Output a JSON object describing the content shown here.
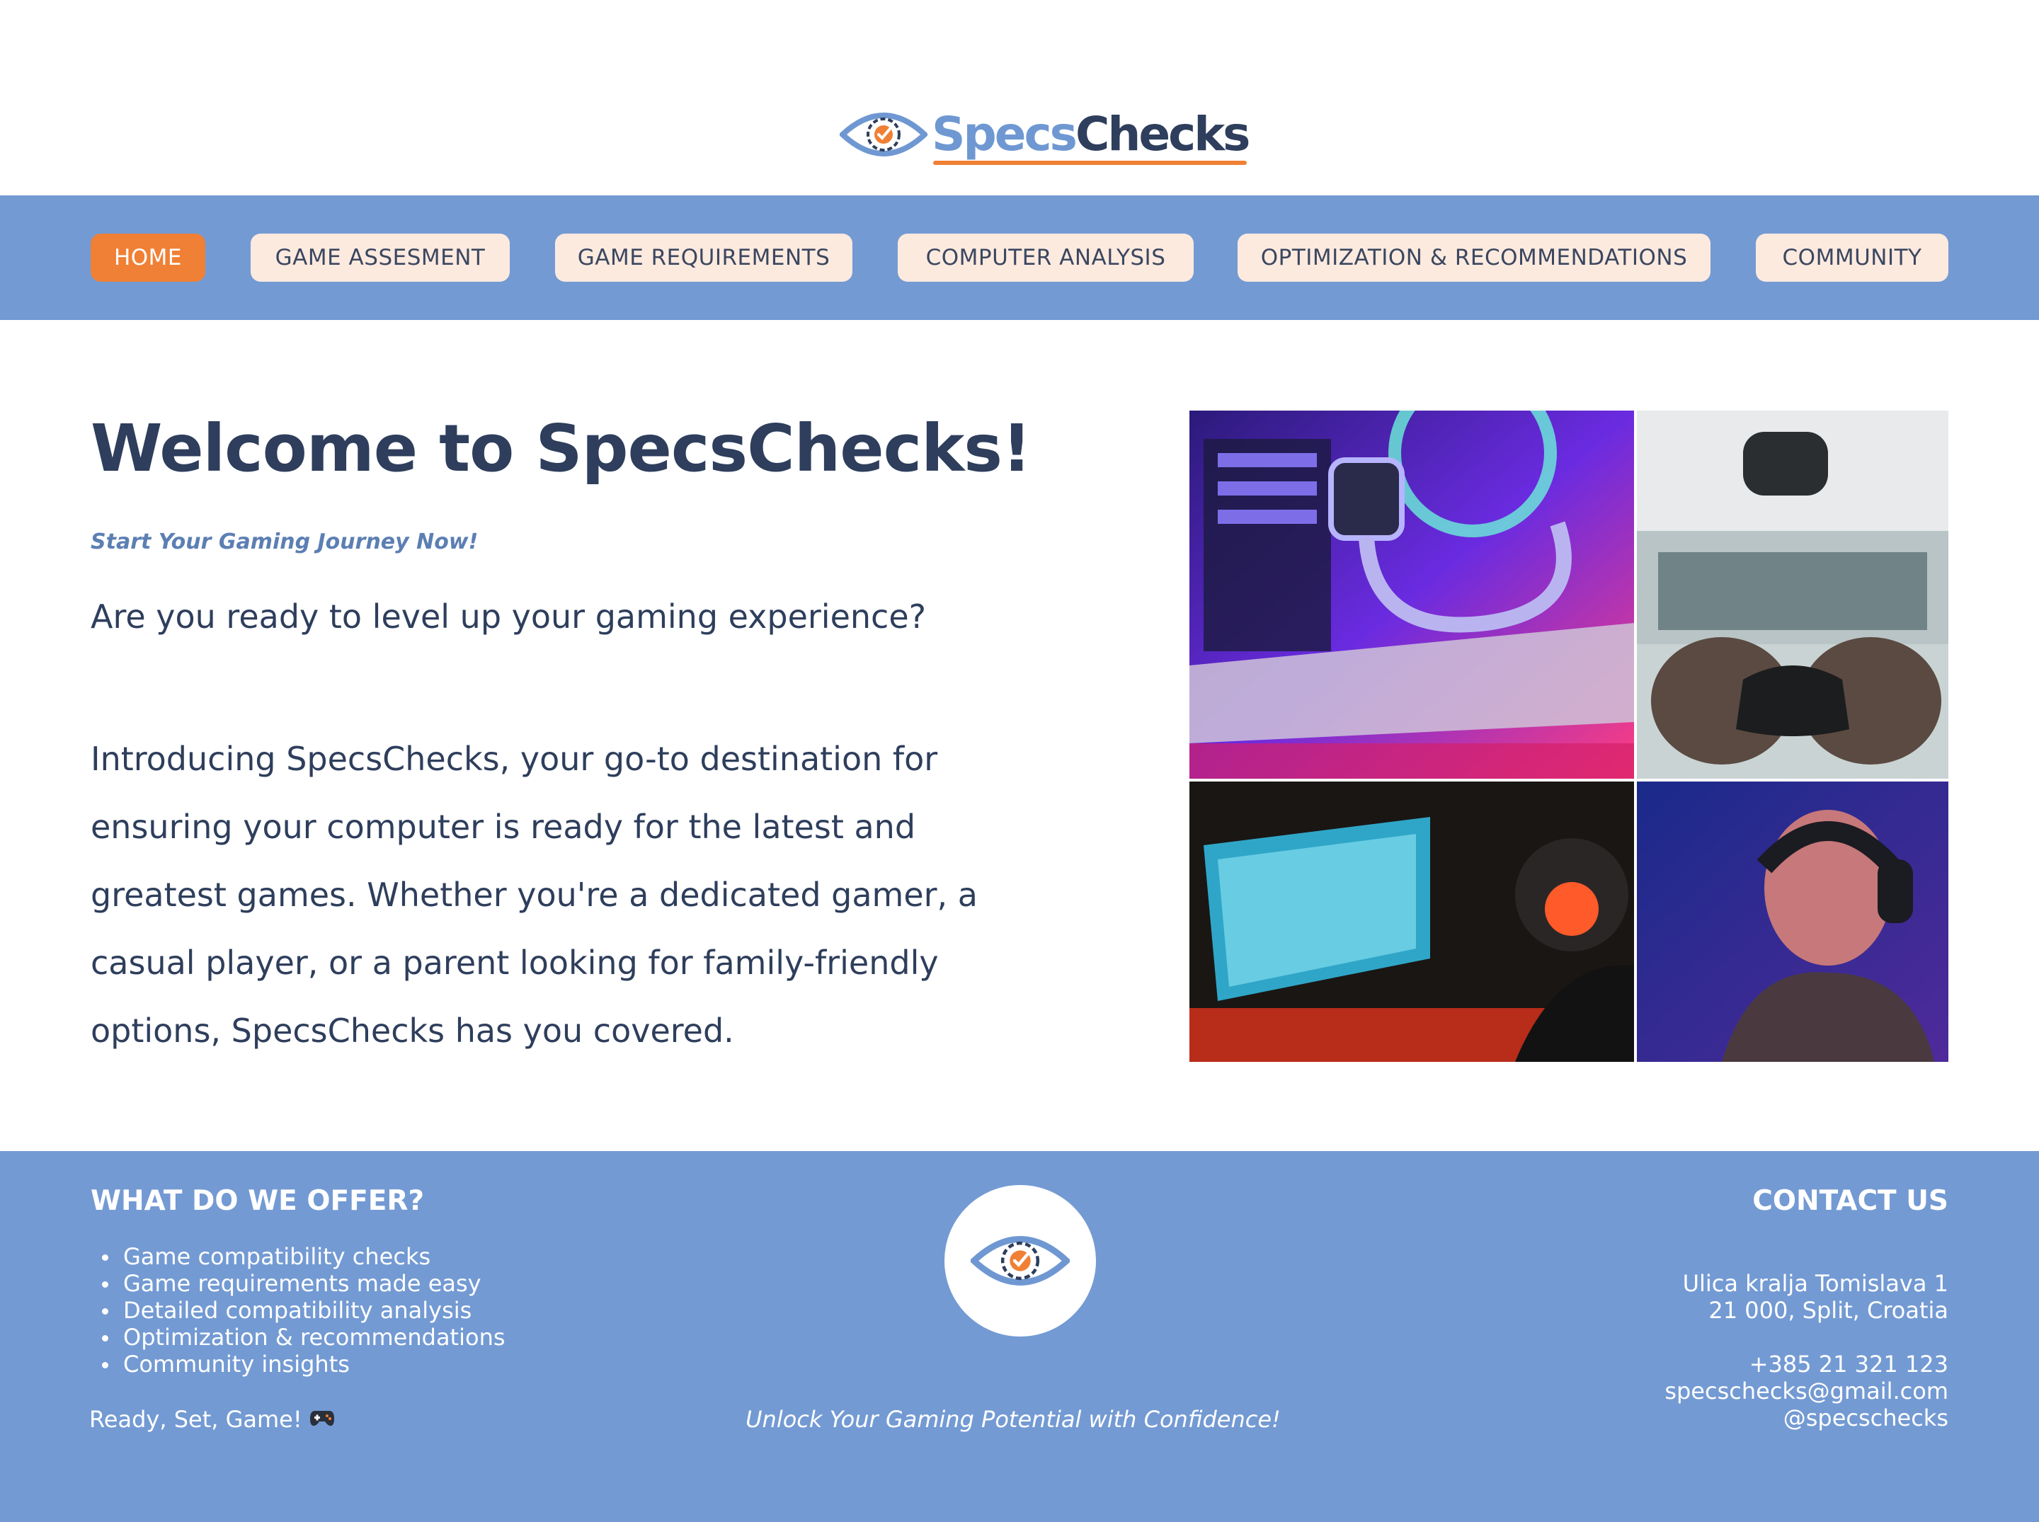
{
  "brand": {
    "name_part1": "Specs",
    "name_part2": "Checks",
    "accent_color": "#f08035",
    "primary_color": "#739ad3",
    "dark_color": "#2e3e5c",
    "logo_icon": "eye-gear-icon"
  },
  "nav": {
    "items": [
      {
        "label": "HOME",
        "active": true
      },
      {
        "label": "GAME ASSESMENT",
        "active": false
      },
      {
        "label": "GAME REQUIREMENTS",
        "active": false
      },
      {
        "label": "COMPUTER ANALYSIS",
        "active": false
      },
      {
        "label": "OPTIMIZATION & RECOMMENDATIONS",
        "active": false
      },
      {
        "label": "COMMUNITY",
        "active": false
      }
    ]
  },
  "hero": {
    "title": "Welcome to SpecsChecks!",
    "tagline": "Start Your Gaming Journey Now!",
    "lead": "Are you ready to level up your gaming experience?",
    "intro_lines": [
      "Introducing SpecsChecks, your go-to destination for",
      "ensuring your computer is ready for the latest and",
      "greatest games. Whether you're a dedicated gamer, a",
      "casual player, or a parent looking for family-friendly",
      "options, SpecsChecks has you covered."
    ]
  },
  "gallery": {
    "photos": [
      "pc-hardware-photo",
      "controller-photo",
      "gamer-monitor-photo",
      "gamer-headset-photo"
    ]
  },
  "footer": {
    "offer_heading": "WHAT DO WE OFFER?",
    "offer_items": [
      "Game compatibility checks",
      "Game requirements made easy",
      "Detailed compatibility analysis",
      "Optimization & recommendations",
      "Community insights"
    ],
    "ready_text": "Ready, Set, Game!",
    "ready_icon": "gamepad-icon",
    "slogan": "Unlock Your Gaming Potential with Confidence!",
    "contact_heading": "CONTACT US",
    "address_line1": "Ulica kralja Tomislava 1",
    "address_line2": "21 000, Split, Croatia",
    "phone": "+385 21 321 123",
    "email": "specschecks@gmail.com",
    "handle": "@specschecks"
  }
}
